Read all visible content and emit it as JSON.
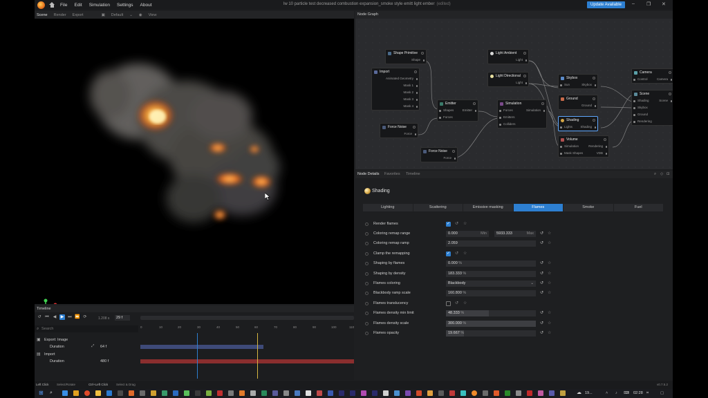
{
  "menu": [
    "File",
    "Edit",
    "Simulation",
    "Settings",
    "About"
  ],
  "doc": {
    "title": "lw 10 particle test decreased combustion expansion_smoke style emitt light ember",
    "edited": "(edited)"
  },
  "update_label": "Update Available",
  "viewport": {
    "tabs": [
      "Scene",
      "Render",
      "Export"
    ],
    "camera_label": "Default",
    "view_label": "View"
  },
  "timeline": {
    "title": "Timeline",
    "fps": "1.208 s",
    "frame": "29 f",
    "search_placeholder": "Search",
    "ruler": [
      "0",
      "10",
      "20",
      "30",
      "40",
      "50",
      "60",
      "70",
      "80",
      "90",
      "100",
      "110"
    ],
    "rows": [
      {
        "label": "Export: Image",
        "value": ""
      },
      {
        "label": "Duration",
        "value": "64 f"
      },
      {
        "label": "Import",
        "value": ""
      },
      {
        "label": "Duration",
        "value": "480 f"
      }
    ]
  },
  "statusbar": {
    "left": "Left Click",
    "left_desc": "Select/Rotate",
    "middle": "Ctrl+Left Click",
    "middle_desc": "Select & Drag",
    "version": "v0.7.5.2"
  },
  "node_graph": {
    "title": "Node Graph",
    "nodes": {
      "shape_primitive": {
        "title": "Shape Primitive",
        "out": "Shape"
      },
      "import": {
        "title": "Import",
        "outs": [
          "Animated Geometry",
          "Mask 1",
          "Mask 2",
          "Mask 3",
          "Mask 4"
        ]
      },
      "force_noise_1": {
        "title": "Force Noise",
        "out": "Force"
      },
      "emitter": {
        "title": "Emitter",
        "in1": "Shapes",
        "out1": "Emitter",
        "in2": "Forces"
      },
      "force_noise_2": {
        "title": "Force Noise",
        "out": "Force"
      },
      "light_ambient": {
        "title": "Light Ambient",
        "out": "Light"
      },
      "light_directional": {
        "title": "Light Directional",
        "out": "Light"
      },
      "simulation": {
        "title": "Simulation",
        "in1": "Forces",
        "out1": "Simulation",
        "in2": "Emitters",
        "in3": "Colliders"
      },
      "skybox": {
        "title": "Skybox",
        "in1": "Sun",
        "out1": "Skybox"
      },
      "ground": {
        "title": "Ground",
        "out": "Ground"
      },
      "shading": {
        "title": "Shading",
        "in1": "Lights",
        "out1": "Shading"
      },
      "volume": {
        "title": "Volume",
        "in1": "Simulation",
        "out1": "Rendering",
        "in2": "Mask Shapes",
        "out2": "VDB"
      },
      "camera": {
        "title": "Camera",
        "in1": "Control",
        "out1": "Camera"
      },
      "scene": {
        "title": "Scene",
        "in1": "Shading",
        "out1": "Scene",
        "ins": [
          "Skybox",
          "Ground",
          "Rendering"
        ]
      }
    }
  },
  "node_details": {
    "tabs": [
      "Node Details",
      "Favorites",
      "Timeline"
    ],
    "title": "Shading",
    "categories": [
      "Lighting",
      "Scattering",
      "Emissive masking",
      "Flames",
      "Smoke",
      "Fuel"
    ],
    "active_category": "Flames",
    "props": [
      {
        "label": "Render flames",
        "type": "check",
        "on": true
      },
      {
        "label": "Coloring remap range",
        "type": "range",
        "min": "0.000",
        "min_label": "Min",
        "max": "5933.333",
        "max_label": "Max"
      },
      {
        "label": "Coloring remap ramp",
        "type": "num",
        "value": "2.059",
        "fill": 0.0
      },
      {
        "label": "Clamp the remapping",
        "type": "check",
        "on": true
      },
      {
        "label": "Shaping by flames",
        "type": "num",
        "value": "0.000",
        "unit": "%",
        "fill": 0.0
      },
      {
        "label": "Shaping by density",
        "type": "num",
        "value": "183.333",
        "unit": "%",
        "fill": 0.0
      },
      {
        "label": "Flames coloring",
        "type": "dropdown",
        "value": "Blackbody"
      },
      {
        "label": "Blackbody ramp scale",
        "type": "num",
        "value": "160.800",
        "unit": "%",
        "fill": 0.0
      },
      {
        "label": "Flames translucency",
        "type": "check",
        "on": false
      },
      {
        "label": "Flames density min limit",
        "type": "num",
        "value": "48.333",
        "unit": "%",
        "fill": 0.48
      },
      {
        "label": "Flames density scale",
        "type": "num",
        "value": "300.000",
        "unit": "%",
        "fill": 1.0
      },
      {
        "label": "Flames opacity",
        "type": "num",
        "value": "19.667",
        "unit": "%",
        "fill": 0.2
      }
    ]
  },
  "taskbar": {
    "time": "02:28",
    "temp": "19..."
  }
}
